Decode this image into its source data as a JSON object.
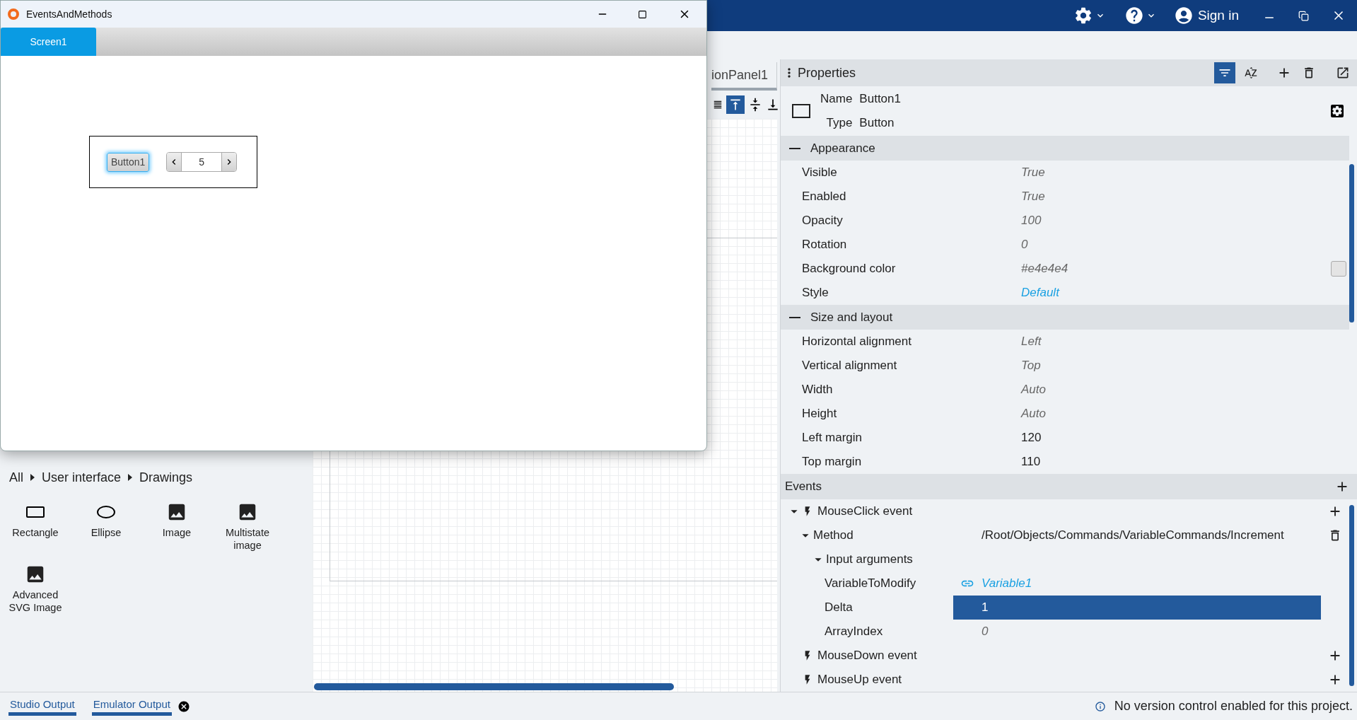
{
  "app_bar": {
    "sign_in": "Sign in"
  },
  "emulator": {
    "title": "EventsAndMethods",
    "tabs": [
      {
        "label": "Screen1",
        "selected": true
      }
    ],
    "button": {
      "label": "Button1",
      "focused": true
    },
    "spinner": {
      "value": "5"
    }
  },
  "editor": {
    "tab": "ionPanel1"
  },
  "library": {
    "breadcrumb": [
      "All",
      "User interface",
      "Drawings"
    ],
    "items": [
      {
        "label": "Rectangle",
        "kind": "rectangle"
      },
      {
        "label": "Ellipse",
        "kind": "ellipse"
      },
      {
        "label": "Image",
        "kind": "image"
      },
      {
        "label": "Multistate image",
        "kind": "image"
      },
      {
        "label": "Advanced SVG Image",
        "kind": "image"
      }
    ]
  },
  "properties": {
    "title": "Properties",
    "name_label": "Name",
    "name": "Button1",
    "type_label": "Type",
    "type": "Button",
    "sections": [
      {
        "title": "Appearance",
        "expanded": true,
        "rows": [
          {
            "label": "Visible",
            "value": "True",
            "kind": "default"
          },
          {
            "label": "Enabled",
            "value": "True",
            "kind": "default"
          },
          {
            "label": "Opacity",
            "value": "100",
            "kind": "default"
          },
          {
            "label": "Rotation",
            "value": "0",
            "kind": "default"
          },
          {
            "label": "Background color",
            "value": "#e4e4e4",
            "kind": "color"
          },
          {
            "label": "Style",
            "value": "Default",
            "kind": "link"
          }
        ]
      },
      {
        "title": "Size and layout",
        "expanded": true,
        "rows": [
          {
            "label": "Horizontal alignment",
            "value": "Left",
            "kind": "default"
          },
          {
            "label": "Vertical alignment",
            "value": "Top",
            "kind": "default"
          },
          {
            "label": "Width",
            "value": "Auto",
            "kind": "default"
          },
          {
            "label": "Height",
            "value": "Auto",
            "kind": "default"
          },
          {
            "label": "Left margin",
            "value": "120",
            "kind": "set"
          },
          {
            "label": "Top margin",
            "value": "110",
            "kind": "set"
          }
        ]
      }
    ]
  },
  "events": {
    "title": "Events",
    "items": [
      {
        "label": "MouseClick event",
        "kind": "event",
        "children": [
          {
            "label": "Method",
            "kind": "method",
            "value": "/Root/Objects/Commands/VariableCommands/Increment",
            "children": [
              {
                "label": "Input arguments",
                "children": [
                  {
                    "label": "VariableToModify",
                    "kind": "link",
                    "value": "Variable1",
                    "selected": false
                  },
                  {
                    "label": "Delta",
                    "kind": "set",
                    "value": "1",
                    "selected": true
                  },
                  {
                    "label": "ArrayIndex",
                    "kind": "default",
                    "value": "0",
                    "selected": false
                  }
                ]
              }
            ]
          }
        ]
      },
      {
        "label": "MouseDown event",
        "kind": "event"
      },
      {
        "label": "MouseUp event",
        "kind": "event"
      }
    ]
  },
  "output_tabs": [
    {
      "label": "Studio Output"
    },
    {
      "label": "Emulator Output"
    }
  ],
  "status": "No version control enabled for this project."
}
